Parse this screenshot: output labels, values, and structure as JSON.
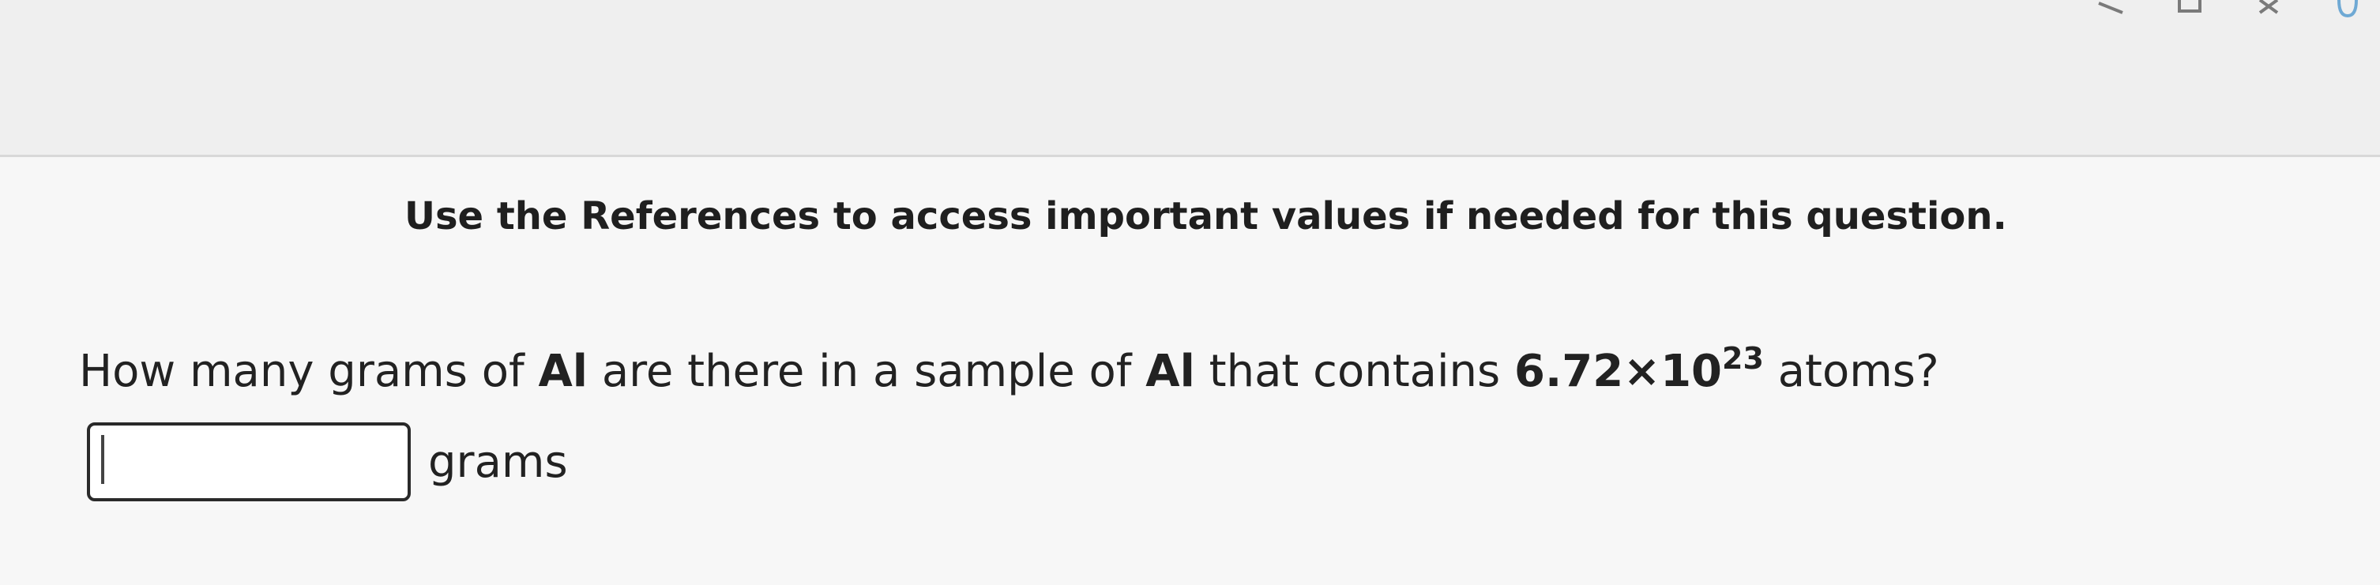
{
  "instruction": {
    "text": "Use the References to access important values if needed for this question."
  },
  "question": {
    "part1": "How many grams of ",
    "element_1": "Al",
    "part2": " are there in a sample of ",
    "element_2": "Al",
    "part3": " that contains ",
    "coefficient": "6.72×10",
    "exponent": "23",
    "part4": " atoms?"
  },
  "answer": {
    "value": "",
    "units": "grams"
  },
  "icons": [
    "partial-toolbar-icon",
    "partial-toolbar-icon",
    "partial-toolbar-icon",
    "partial-toolbar-icon"
  ]
}
